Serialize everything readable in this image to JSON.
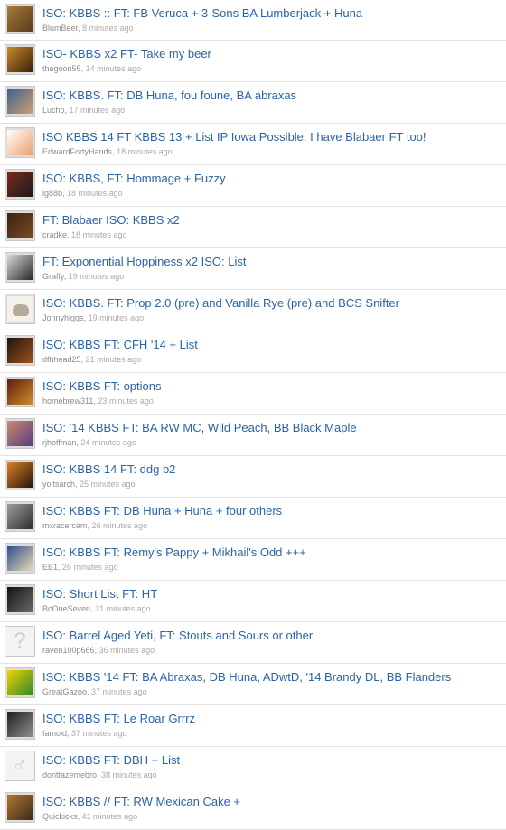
{
  "threads": [
    {
      "title": "ISO: KBBS :: FT: FB Veruca + 3-Sons BA Lumberjack + Huna",
      "user": "BlumBeer",
      "time": "8 minutes ago",
      "avatar": "beer-can-photo-icon",
      "colors": [
        "#a77a3c",
        "#5a3b1c"
      ]
    },
    {
      "title": "ISO- KBBS x2 FT- Take my beer",
      "user": "thegoon55",
      "time": "14 minutes ago",
      "avatar": "beer-bottle-photo-icon",
      "colors": [
        "#c98a2d",
        "#3b2008"
      ]
    },
    {
      "title": "ISO: KBBS. FT: DB Huna, fou foune, BA abraxas",
      "user": "Lucho",
      "time": "17 minutes ago",
      "avatar": "person-photo-icon",
      "colors": [
        "#3f5f8e",
        "#c7a06e"
      ]
    },
    {
      "title": "ISO KBBS 14 FT KBBS 13 + List IP Iowa Possible. I have Blabaer FT too!",
      "user": "EdwardFortyHands",
      "time": "18 minutes ago",
      "avatar": "cartoon-face-icon",
      "colors": [
        "#ffffff",
        "#e9a06a"
      ]
    },
    {
      "title": "ISO: KBBS, FT: Hommage + Fuzzy",
      "user": "ig88b",
      "time": "18 minutes ago",
      "avatar": "beer-label-photo-icon",
      "colors": [
        "#7b2a1d",
        "#1b1b1b"
      ]
    },
    {
      "title": "FT: Blabaer ISO: KBBS x2",
      "user": "cradke",
      "time": "18 minutes ago",
      "avatar": "bottles-photo-icon",
      "colors": [
        "#3a2414",
        "#7a4a22"
      ]
    },
    {
      "title": "FT: Exponential Hoppiness x2 ISO: List",
      "user": "Graffy",
      "time": "19 minutes ago",
      "avatar": "portrait-photo-icon",
      "colors": [
        "#d9d9d9",
        "#2b2b2b"
      ]
    },
    {
      "title": "ISO: KBBS. FT: Prop 2.0 (pre) and Vanilla Rye (pre) and BCS Snifter",
      "user": "Jonnyhiggs",
      "time": "19 minutes ago",
      "avatar": "cat-illustration-icon",
      "colors": [
        "#f4f1ec",
        "#b7ab9c"
      ]
    },
    {
      "title": "ISO: KBBS FT: CFH '14 + List",
      "user": "dfhhead25",
      "time": "21 minutes ago",
      "avatar": "bar-photo-icon",
      "colors": [
        "#1a1410",
        "#a0521e"
      ]
    },
    {
      "title": "ISO: KBBS FT: options",
      "user": "homebrew311",
      "time": "23 minutes ago",
      "avatar": "bottles-row-photo-icon",
      "colors": [
        "#5a1f0f",
        "#d28a2b"
      ]
    },
    {
      "title": "ISO: '14 KBBS FT: BA RW MC, Wild Peach, BB Black Maple",
      "user": "rjhoffman",
      "time": "24 minutes ago",
      "avatar": "face-photo-icon",
      "colors": [
        "#c98b74",
        "#5b3b7a"
      ]
    },
    {
      "title": "ISO: KBBS 14 FT: ddg b2",
      "user": "yoitsarch",
      "time": "25 minutes ago",
      "avatar": "beer-glass-photo-icon",
      "colors": [
        "#d9822b",
        "#2a1608"
      ]
    },
    {
      "title": "ISO: KBBS FT: DB Huna + Huna + four others",
      "user": "mxracercam",
      "time": "26 minutes ago",
      "avatar": "bottles-bw-photo-icon",
      "colors": [
        "#9e9e9e",
        "#2d2d2d"
      ]
    },
    {
      "title": "ISO: KBBS FT: Remy's Pappy + Mikhail's Odd +++",
      "user": "EB1",
      "time": "26 minutes ago",
      "avatar": "mug-photo-icon",
      "colors": [
        "#2c4a8a",
        "#e7d9b6"
      ]
    },
    {
      "title": "ISO: Short List FT: HT",
      "user": "BcOneSeven",
      "time": "31 minutes ago",
      "avatar": "dark-photo-icon",
      "colors": [
        "#111111",
        "#6b6b6b"
      ]
    },
    {
      "title": "ISO: Barrel Aged Yeti, FT: Stouts and Sours or other",
      "user": "raven100p666",
      "time": "36 minutes ago",
      "avatar": "question-mark-icon",
      "colors": [
        "#f3f3f3",
        "#cfcfcf"
      ]
    },
    {
      "title": "ISO: KBBS '14 FT: BA Abraxas, DB Huna, ADwtD, '14 Brandy DL, BB Flanders",
      "user": "GreatGazoo",
      "time": "37 minutes ago",
      "avatar": "cartoon-green-icon",
      "colors": [
        "#f2d200",
        "#2f8a2a"
      ]
    },
    {
      "title": "ISO: KBBS FT: Le Roar Grrrz",
      "user": "famoid",
      "time": "37 minutes ago",
      "avatar": "bottle-bw-photo-icon",
      "colors": [
        "#1f1f1f",
        "#8d8d8d"
      ]
    },
    {
      "title": "ISO: KBBS FT: DBH + List",
      "user": "donttazemebro",
      "time": "38 minutes ago",
      "avatar": "male-symbol-icon",
      "colors": [
        "#f3f3f3",
        "#cfcfcf"
      ]
    },
    {
      "title": "ISO: KBBS // FT: RW Mexican Cake +",
      "user": "Quickicks",
      "time": "41 minutes ago",
      "avatar": "group-photo-icon",
      "colors": [
        "#b4762f",
        "#3b2a1a"
      ]
    }
  ]
}
